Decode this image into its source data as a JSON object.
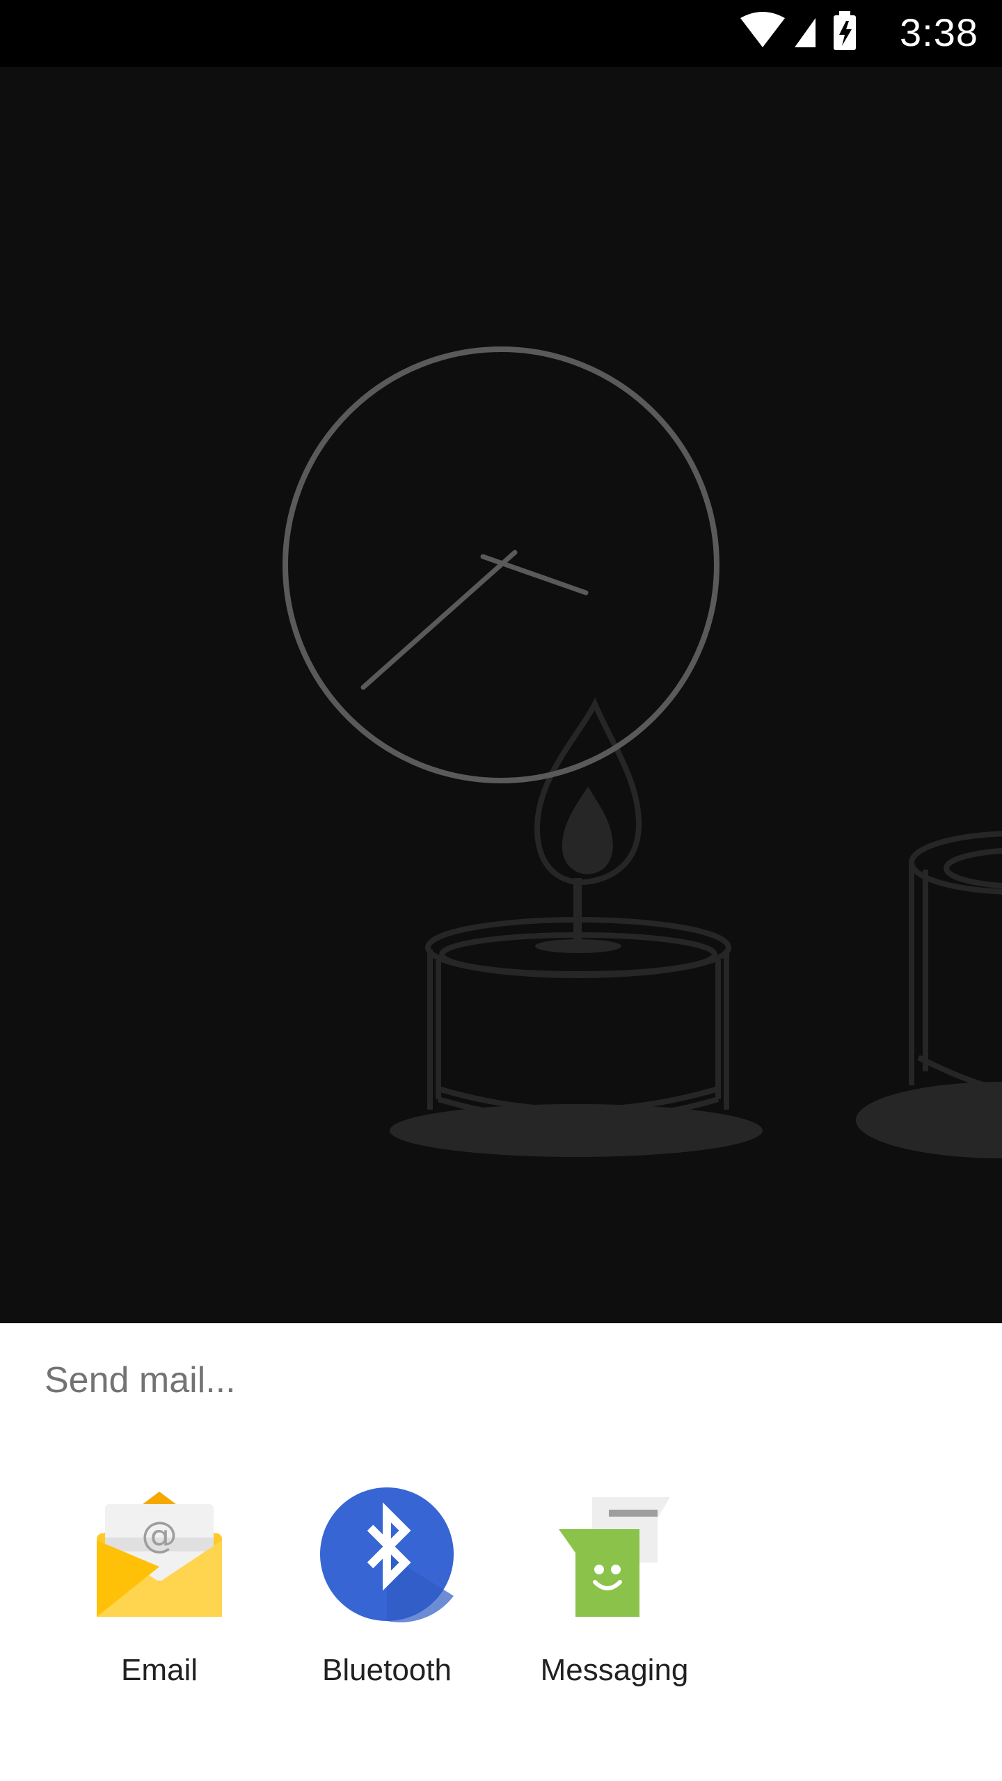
{
  "status_bar": {
    "time": "3:38",
    "icons": [
      "wifi-icon",
      "cell-signal-icon",
      "battery-charging-icon"
    ]
  },
  "background": {
    "illustration": [
      "clock-icon",
      "candle-icon"
    ],
    "colors": {
      "background": "#0e0e0e",
      "clock": "#5a5a5a",
      "candle": "#262626"
    }
  },
  "share_sheet": {
    "title": "Send mail...",
    "targets": [
      {
        "label": "Email",
        "icon": "email-app-icon"
      },
      {
        "label": "Bluetooth",
        "icon": "bluetooth-app-icon"
      },
      {
        "label": "Messaging",
        "icon": "messaging-app-icon"
      }
    ]
  }
}
